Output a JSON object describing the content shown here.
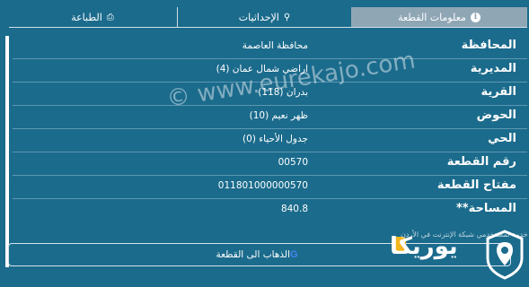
{
  "tabs": {
    "print": "الطباعة",
    "coordinates": "الإحداثيات",
    "parcel_info": "معلومات القطعة"
  },
  "rows": [
    {
      "label": "المحافظة",
      "value": "محافظة العاصمة"
    },
    {
      "label": "المديرية",
      "value": "اراضي شمال عمان (4)"
    },
    {
      "label": "القرية",
      "value": "بدران (118)"
    },
    {
      "label": "الحوض",
      "value": "ظهر نعيم (10)"
    },
    {
      "label": "الحي",
      "value": "جدول الأحياء (0)"
    },
    {
      "label": "رقم القطعة",
      "value": "00570"
    },
    {
      "label": "مفتاح القطعة",
      "value": "011801000000570"
    },
    {
      "label": "المساحة**",
      "value": "840.8"
    }
  ],
  "actions": {
    "goto_parcel": "الذهاب الى القطعة",
    "google_glyph": "G"
  },
  "watermark": "© www.eurekajo.com",
  "logo": {
    "text": "يوريكا",
    "tagline": "خدمة لمستخدمي شبكة الإنترنت في الأردن"
  },
  "colors": {
    "background": "#1b6b8c",
    "active_tab": "#8fa7b5",
    "logo_accent": "#f2b51c"
  },
  "icons": {
    "print": "printer-icon",
    "coordinates": "map-pin-icon",
    "info": "info-icon",
    "google": "google-icon"
  }
}
